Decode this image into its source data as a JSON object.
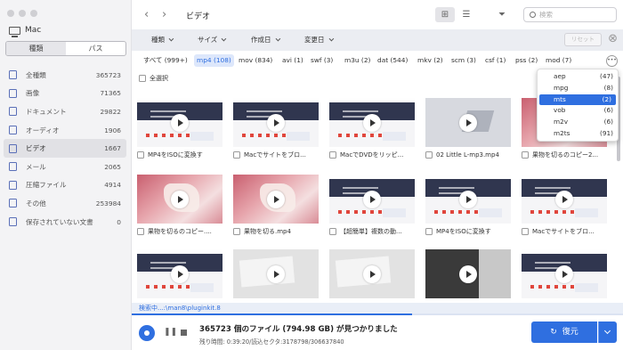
{
  "sidebar": {
    "device": "Mac",
    "tabs": [
      "種類",
      "パス"
    ],
    "items": [
      {
        "label": "全種類",
        "count": "365723",
        "icon": "all-types-icon"
      },
      {
        "label": "画像",
        "count": "71365",
        "icon": "image-icon"
      },
      {
        "label": "ドキュメント",
        "count": "29822",
        "icon": "document-icon"
      },
      {
        "label": "オーディオ",
        "count": "1906",
        "icon": "audio-icon"
      },
      {
        "label": "ビデオ",
        "count": "1667",
        "icon": "video-icon"
      },
      {
        "label": "メール",
        "count": "2065",
        "icon": "mail-icon"
      },
      {
        "label": "圧縮ファイル",
        "count": "4914",
        "icon": "archive-icon"
      },
      {
        "label": "その他",
        "count": "253984",
        "icon": "other-icon"
      },
      {
        "label": "保存されていない文書",
        "count": "0",
        "icon": "unsaved-doc-icon"
      }
    ]
  },
  "header": {
    "back": "‹",
    "forward": "›",
    "title": "ビデオ",
    "search_placeholder": "検索"
  },
  "filters": {
    "dropdowns": [
      "種類",
      "サイズ",
      "作成日",
      "変更日"
    ],
    "reset": "リセット"
  },
  "extensions": [
    "すべて (999+)",
    "mp4 (108)",
    "mov (834)",
    "avi (1)",
    "swf (3)",
    "m3u (2)",
    "dat (544)",
    "mkv (2)",
    "scm (3)",
    "csf (1)",
    "pss (2)",
    "mod (7)"
  ],
  "select_all": "全選択",
  "ext_popup": [
    {
      "ext": "aep",
      "count": "(47)"
    },
    {
      "ext": "mpg",
      "count": "(8)"
    },
    {
      "ext": "mts",
      "count": "(2)"
    },
    {
      "ext": "vob",
      "count": "(6)"
    },
    {
      "ext": "m2v",
      "count": "(6)"
    },
    {
      "ext": "m2ts",
      "count": "(91)"
    }
  ],
  "files": [
    {
      "name": "MP4をISOに変換す",
      "thumb": "site"
    },
    {
      "name": "Macでサイトをブロ...",
      "thumb": "site"
    },
    {
      "name": "MacでDVDをリッピ...",
      "thumb": "site"
    },
    {
      "name": "02 Little L-mp3.mp4",
      "thumb": "gray"
    },
    {
      "name": "果物を切るのコピー2...",
      "thumb": "hand"
    },
    {
      "name": "果物を切るのコピー....",
      "thumb": "hand"
    },
    {
      "name": "果物を切る.mp4",
      "thumb": "hand"
    },
    {
      "name": "【超簡単】複数の動...",
      "thumb": "site"
    },
    {
      "name": "MP4をISOに変換す",
      "thumb": "site"
    },
    {
      "name": "Macでサイトをブロ...",
      "thumb": "site"
    },
    {
      "name": "",
      "thumb": "site"
    },
    {
      "name": "",
      "thumb": "desk"
    },
    {
      "name": "",
      "thumb": "desk"
    },
    {
      "name": "",
      "thumb": "dvd"
    },
    {
      "name": "",
      "thumb": "site"
    }
  ],
  "status": {
    "scanning": "検索中...:\\man8\\pluginkit.8",
    "progress": 0.57,
    "found": "365723 個のファイル (794.98 GB) が見つかりました",
    "remaining": "残り時間: 0:39:20/読込セクタ:3178798/306637840"
  },
  "recover_button": "復元",
  "accent_color": "#2f6fe0"
}
